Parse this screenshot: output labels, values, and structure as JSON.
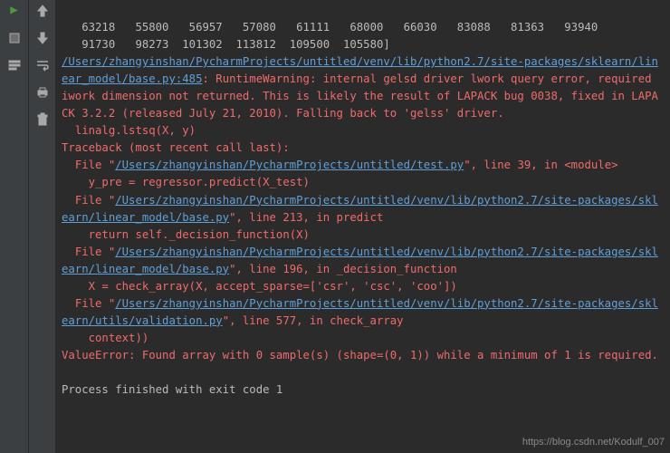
{
  "nums_line1": "   63218   55800   56957   57080   61111   68000   66030   83088   81363   93940",
  "nums_line2": "   91730   98273  101302  113812  109500  105580]",
  "warn_path": "/Users/zhangyinshan/PycharmProjects/untitled/venv/lib/python2.7/site-packages/sklearn/linear_model/base.py:485",
  "warn_pre": ": RuntimeWarning: internal gelsd driver lwork query error, required iwork dimension not returned. This is likely the result of LAPACK bug 0038, fixed in LAPACK 3.2.2 (released July 21, 2010). Falling back to 'gelss' driver.",
  "warn_line": "  linalg.lstsq(X, y)",
  "tb_head": "Traceback (most recent call last):",
  "f1_pre": "  File \"",
  "f1_path": "/Users/zhangyinshan/PycharmProjects/untitled/test.py",
  "f1_post": "\", line 39, in <module>",
  "f1_code": "    y_pre = regressor.predict(X_test)",
  "f2_pre": "  File \"",
  "f2_path": "/Users/zhangyinshan/PycharmProjects/untitled/venv/lib/python2.7/site-packages/sklearn/linear_model/base.py",
  "f2_post": "\", line 213, in predict",
  "f2_code": "    return self._decision_function(X)",
  "f3_pre": "  File \"",
  "f3_path": "/Users/zhangyinshan/PycharmProjects/untitled/venv/lib/python2.7/site-packages/sklearn/linear_model/base.py",
  "f3_post": "\", line 196, in _decision_function",
  "f3_code": "    X = check_array(X, accept_sparse=['csr', 'csc', 'coo'])",
  "f4_pre": "  File \"",
  "f4_path": "/Users/zhangyinshan/PycharmProjects/untitled/venv/lib/python2.7/site-packages/sklearn/utils/validation.py",
  "f4_post": "\", line 577, in check_array",
  "f4_code": "    context))",
  "err": "ValueError: Found array with 0 sample(s) (shape=(0, 1)) while a minimum of 1 is required.",
  "exit": "Process finished with exit code 1",
  "watermark": "https://blog.csdn.net/Kodulf_007"
}
